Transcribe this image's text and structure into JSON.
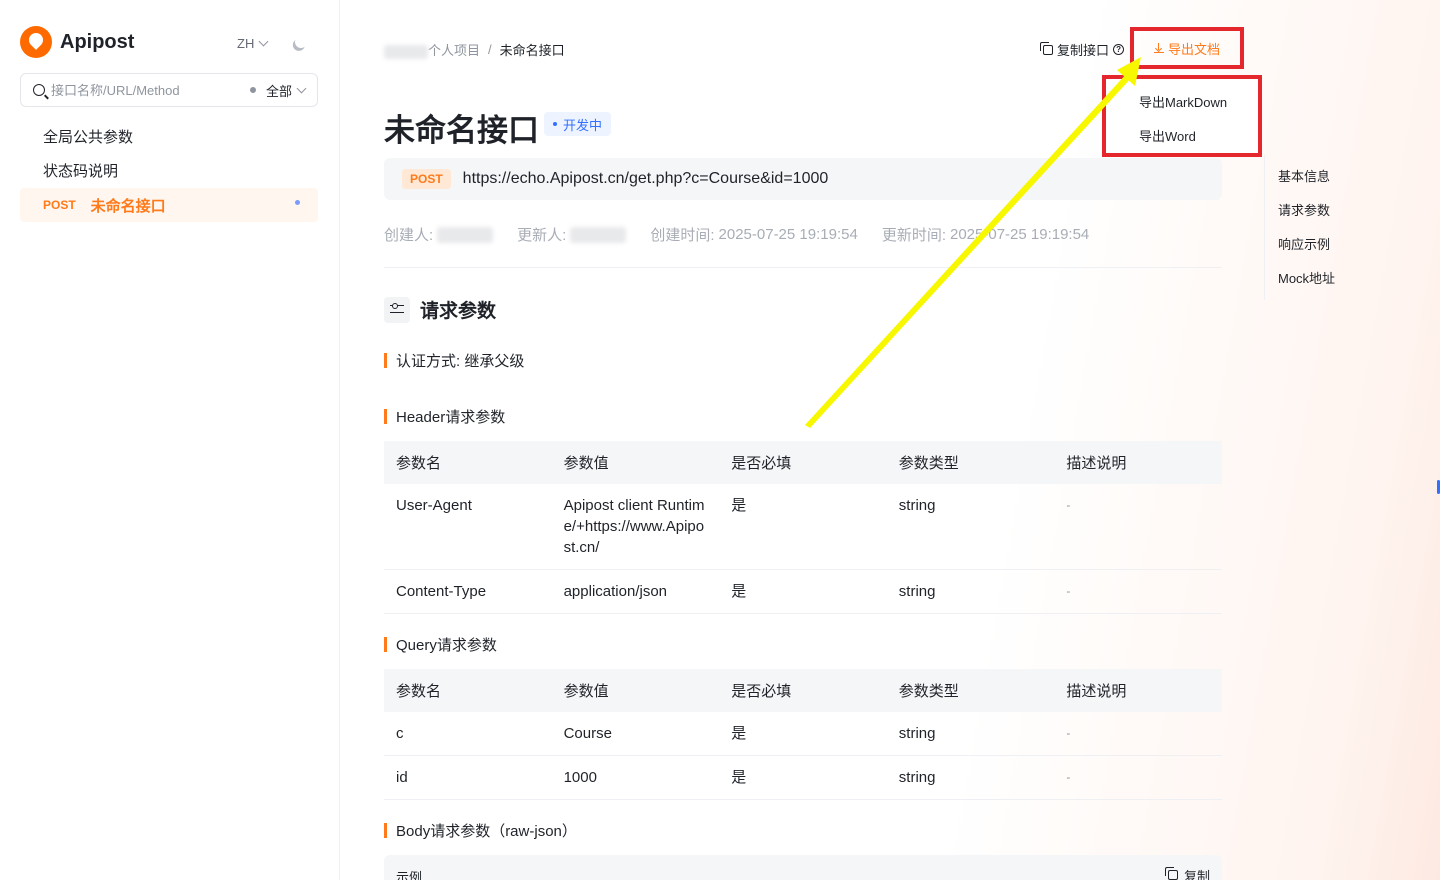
{
  "brand": {
    "name": "Apipost"
  },
  "header_controls": {
    "language": "ZH"
  },
  "search": {
    "placeholder": "接口名称/URL/Method",
    "filter_label": "全部"
  },
  "tree": {
    "items": [
      {
        "label": "全局公共参数"
      },
      {
        "label": "状态码说明"
      }
    ],
    "active": {
      "method": "POST",
      "label": "未命名接口"
    }
  },
  "breadcrumb": {
    "project": "个人项目",
    "separator": "/",
    "current": "未命名接口"
  },
  "toolbar": {
    "copy_api_label": "复制接口",
    "export_doc_label": "导出文档"
  },
  "export_menu": {
    "items": [
      "导出MarkDown",
      "导出Word"
    ]
  },
  "api": {
    "title": "未命名接口",
    "status": "开发中",
    "method": "POST",
    "url": "https://echo.Apipost.cn/get.php?c=Course&id=1000"
  },
  "meta": {
    "creator_label": "创建人:",
    "updater_label": "更新人:",
    "created_label": "创建时间:",
    "created_value": "2025-07-25 19:19:54",
    "updated_label": "更新时间:",
    "updated_value": "2025-07-25 19:19:54"
  },
  "request_section": {
    "title": "请求参数",
    "auth": "认证方式: 继承父级",
    "header_title": "Header请求参数",
    "query_title": "Query请求参数",
    "body_title": "Body请求参数（raw-json）",
    "columns": [
      "参数名",
      "参数值",
      "是否必填",
      "参数类型",
      "描述说明"
    ],
    "header_rows": [
      [
        "User-Agent",
        "Apipost client Runtime/+https://www.Apipost.cn/",
        "是",
        "string",
        "-"
      ],
      [
        "Content-Type",
        "application/json",
        "是",
        "string",
        "-"
      ]
    ],
    "query_rows": [
      [
        "c",
        "Course",
        "是",
        "string",
        "-"
      ],
      [
        "id",
        "1000",
        "是",
        "string",
        "-"
      ]
    ],
    "example_label": "示例",
    "copy_label": "复制"
  },
  "anchors": [
    "基本信息",
    "请求参数",
    "响应示例",
    "Mock地址"
  ],
  "colors": {
    "accent": "#ff7a1a",
    "annotation_red": "#e4262d",
    "annotation_arrow": "#f7f700",
    "status_blue": "#3370ff"
  },
  "icons": [
    "logo-icon",
    "chevron-down-icon",
    "moon-icon",
    "search-icon",
    "copy-icon",
    "help-icon",
    "download-icon",
    "params-icon"
  ]
}
